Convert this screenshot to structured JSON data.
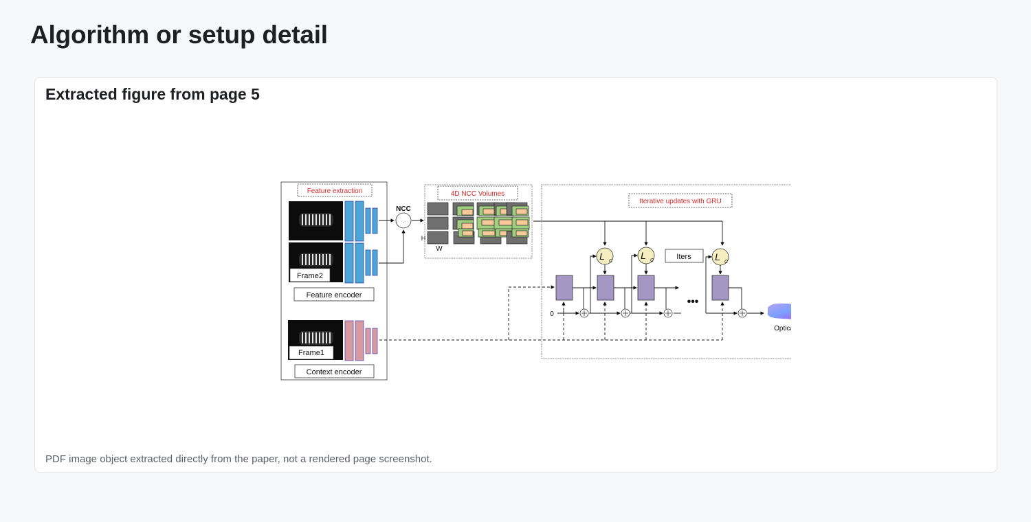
{
  "page": {
    "title": "Algorithm or setup detail"
  },
  "card": {
    "title": "Extracted figure from page 5",
    "caption": "PDF image object extracted directly from the paper, not a rendered page screenshot."
  },
  "figure": {
    "feature_extraction_label": "Feature extraction",
    "frame2_label": "Frame2",
    "frame1_label": "Frame1",
    "feature_encoder_label": "Feature encoder",
    "context_encoder_label": "Context encoder",
    "ncc_label": "NCC",
    "ncc_volumes_label": "4D NCC Volumes",
    "h_label": "H",
    "w_label": "W",
    "gru_label": "Iterative updates with GRU",
    "iters_label": "Iters",
    "lc_label": "L",
    "lc_sub": "C",
    "zero_label": "0",
    "dots_label": "•••",
    "optical_flow_label": "Optical flow",
    "colors": {
      "annotation_red": "#d42a2a",
      "encoder_blue": "#4ba6d6",
      "context_pink": "#d79aa0",
      "gru_purple": "#a497c3",
      "lookup_cream": "#f6eec1",
      "volume_green": "#9fcf7f",
      "volume_peach": "#f7c99b",
      "volume_gray": "#6f6f6f"
    }
  }
}
